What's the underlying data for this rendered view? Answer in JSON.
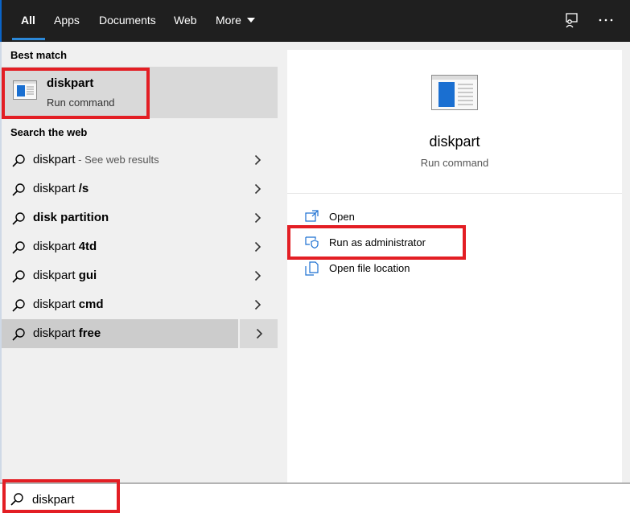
{
  "tabs": [
    {
      "label": "All",
      "active": true
    },
    {
      "label": "Apps",
      "active": false
    },
    {
      "label": "Documents",
      "active": false
    },
    {
      "label": "Web",
      "active": false
    },
    {
      "label": "More",
      "active": false
    }
  ],
  "top_icons": [
    "feedback-icon",
    "more-options-icon"
  ],
  "best_match": {
    "header": "Best match",
    "title": "diskpart",
    "subtitle": "Run command",
    "icon": "run-command-icon"
  },
  "web": {
    "header": "Search the web",
    "results": [
      {
        "prefix": "diskpart",
        "bold": "",
        "suffix": " - See web results"
      },
      {
        "prefix": "diskpart ",
        "bold": "/s",
        "suffix": ""
      },
      {
        "prefix": "",
        "bold": "disk partition",
        "suffix": ""
      },
      {
        "prefix": "diskpart ",
        "bold": "4td",
        "suffix": ""
      },
      {
        "prefix": "diskpart ",
        "bold": "gui",
        "suffix": ""
      },
      {
        "prefix": "diskpart ",
        "bold": "cmd",
        "suffix": ""
      },
      {
        "prefix": "diskpart ",
        "bold": "free",
        "suffix": ""
      }
    ]
  },
  "detail": {
    "title": "diskpart",
    "subtitle": "Run command",
    "actions": [
      {
        "label": "Open",
        "icon": "open-icon"
      },
      {
        "label": "Run as administrator",
        "icon": "shield-icon"
      },
      {
        "label": "Open file location",
        "icon": "file-location-icon"
      }
    ]
  },
  "search": {
    "value": "diskpart",
    "icon": "search-icon"
  },
  "colors": {
    "accent": "#2b88d8",
    "callout": "#e31e24",
    "topbar": "#1f1f1f"
  }
}
